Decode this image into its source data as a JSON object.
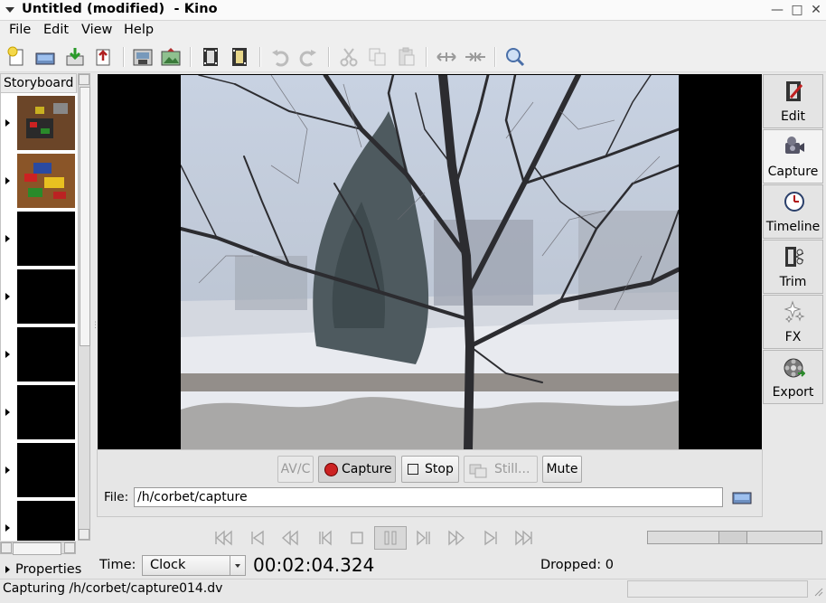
{
  "window": {
    "title": "Untitled (modified)  - Kino"
  },
  "menu": {
    "file": "File",
    "edit": "Edit",
    "view": "View",
    "help": "Help"
  },
  "storyboard": {
    "title": "Storyboard",
    "properties_label": "Properties"
  },
  "capture": {
    "avc_label": "AV/C",
    "capture_label": "Capture",
    "stop_label": "Stop",
    "still_label": "Still...",
    "mute_label": "Mute",
    "file_label": "File:",
    "file_value": "/h/corbet/capture"
  },
  "modes": [
    {
      "label": "Edit",
      "icon": "edit-icon"
    },
    {
      "label": "Capture",
      "icon": "camcorder-icon"
    },
    {
      "label": "Timeline",
      "icon": "clock-icon"
    },
    {
      "label": "Trim",
      "icon": "trim-icon"
    },
    {
      "label": "FX",
      "icon": "fx-icon"
    },
    {
      "label": "Export",
      "icon": "export-icon"
    }
  ],
  "transport": {
    "time_label": "Time:",
    "time_mode": "Clock",
    "timecode": "00:02:04.324",
    "dropped": "Dropped: 0"
  },
  "status": {
    "text": "Capturing /h/corbet/capture014.dv"
  },
  "colors": {
    "accent_red": "#cc2222",
    "video_bg": "#000000"
  }
}
